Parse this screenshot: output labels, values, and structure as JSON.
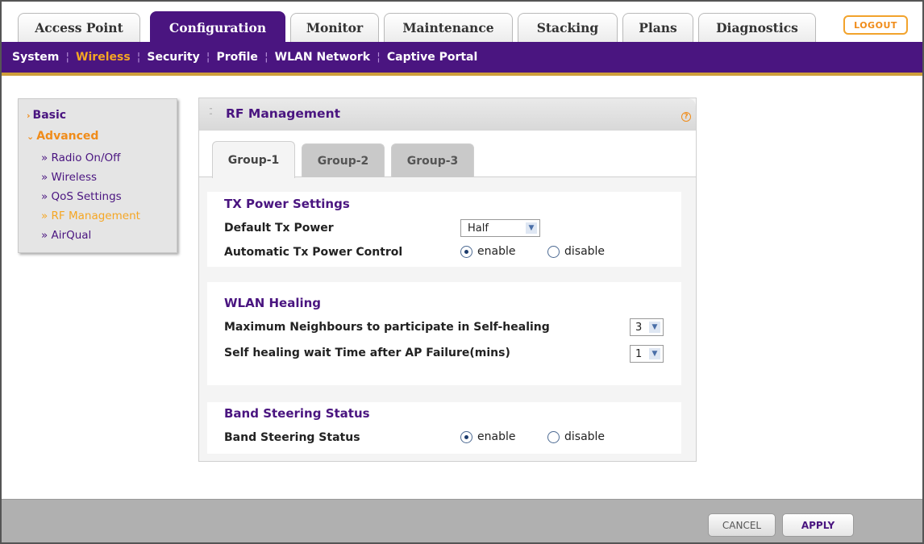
{
  "top_tabs": [
    {
      "label": "Access Point"
    },
    {
      "label": "Configuration"
    },
    {
      "label": "Monitor"
    },
    {
      "label": "Maintenance"
    },
    {
      "label": "Stacking"
    },
    {
      "label": "Plans"
    },
    {
      "label": "Diagnostics"
    }
  ],
  "logout_label": "LOGOUT",
  "subnav": [
    {
      "label": "System"
    },
    {
      "label": "Wireless"
    },
    {
      "label": "Security"
    },
    {
      "label": "Profile"
    },
    {
      "label": "WLAN Network"
    },
    {
      "label": "Captive Portal"
    }
  ],
  "leftmenu": {
    "basic": "Basic",
    "advanced": "Advanced",
    "items": [
      {
        "label": "» Radio On/Off"
      },
      {
        "label": "» Wireless"
      },
      {
        "label": "» QoS Settings"
      },
      {
        "label": "» RF Management"
      },
      {
        "label": "» AirQual"
      }
    ]
  },
  "panel": {
    "title": "RF Management",
    "help": "?",
    "tabs": [
      {
        "label": "Group-1"
      },
      {
        "label": "Group-2"
      },
      {
        "label": "Group-3"
      }
    ],
    "tx": {
      "title": "TX Power Settings",
      "default_label": "Default Tx Power",
      "default_value": "Half",
      "auto_label": "Automatic Tx Power Control",
      "enable": "enable",
      "disable": "disable"
    },
    "healing": {
      "title": "WLAN Healing",
      "max_label": "Maximum Neighbours to participate in Self-healing",
      "max_value": "3",
      "wait_label": "Self healing wait Time after AP Failure(mins)",
      "wait_value": "1"
    },
    "band": {
      "title": "Band Steering Status",
      "label": "Band Steering Status",
      "enable": "enable",
      "disable": "disable"
    }
  },
  "buttons": {
    "cancel": "CANCEL",
    "apply": "APPLY"
  },
  "colors": {
    "brand_purple": "#4a1580",
    "accent_orange": "#f08c1a"
  },
  "icons": {
    "select_chevron": "chevron-down-icon",
    "help": "help-icon"
  }
}
